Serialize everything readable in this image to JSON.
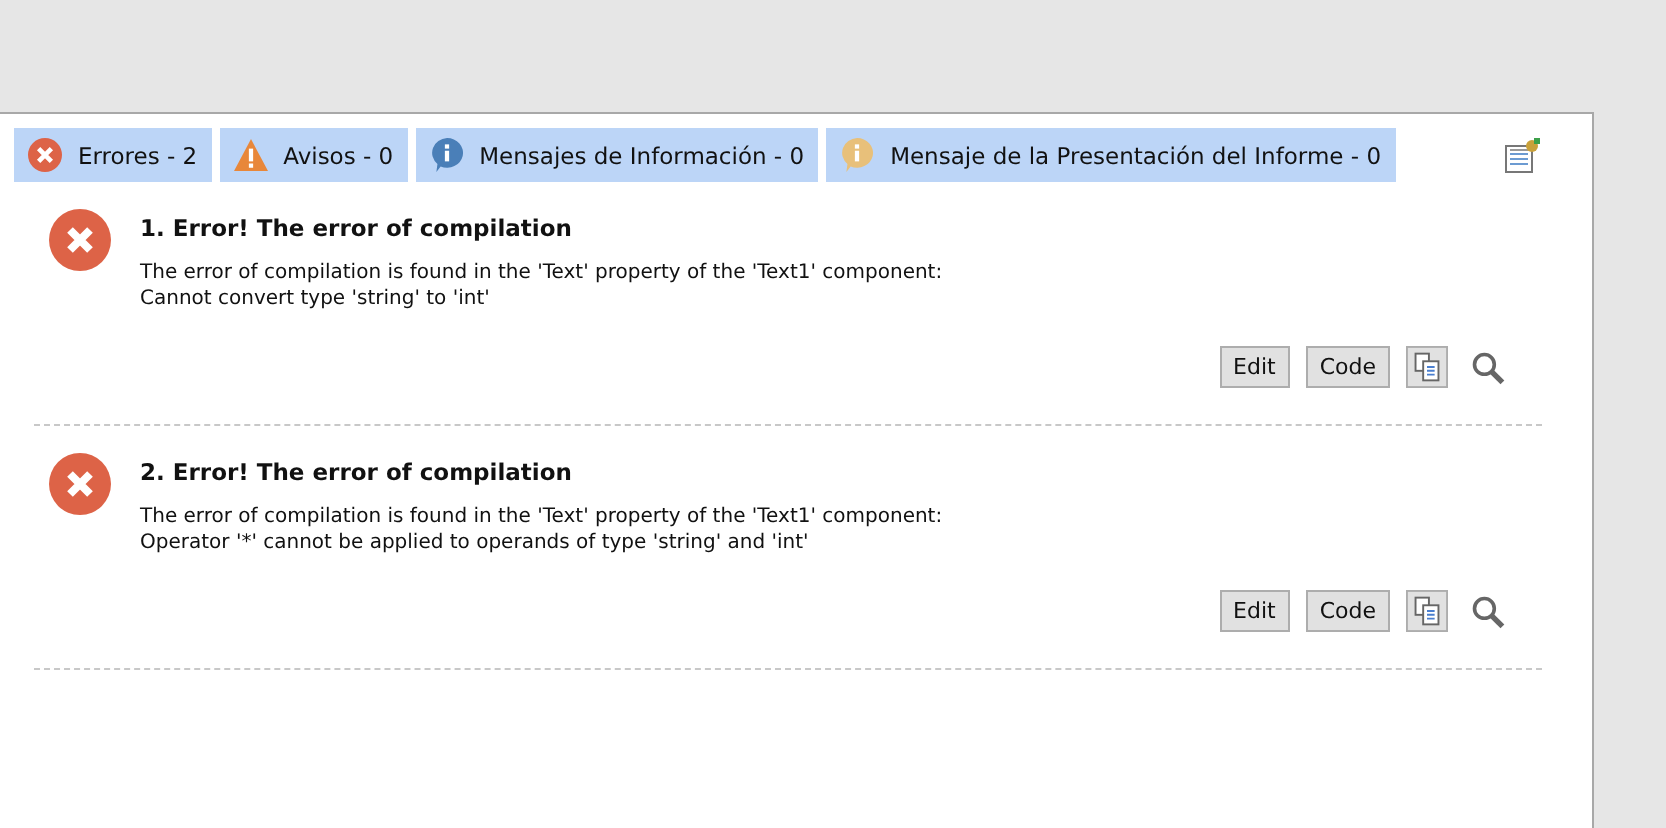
{
  "tabs": [
    {
      "kind": "error",
      "label": "Errores - 2"
    },
    {
      "kind": "warning",
      "label": "Avisos - 0"
    },
    {
      "kind": "info",
      "label": "Mensajes de Información - 0"
    },
    {
      "kind": "report",
      "label": "Mensaje de la Presentación del Informe - 0"
    }
  ],
  "messages": [
    {
      "title": "1. Error! The error of compilation",
      "lines": [
        "The error of compilation is found in the 'Text' property of the 'Text1' component:",
        "Cannot convert type 'string' to 'int'"
      ],
      "buttons": [
        "Edit",
        "Code"
      ]
    },
    {
      "title": "2. Error! The error of compilation",
      "lines": [
        "The error of compilation is found in the 'Text' property of the 'Text1' component:",
        "Operator '*' cannot be applied to operands of type 'string' and 'int'"
      ],
      "buttons": [
        "Edit",
        "Code"
      ]
    }
  ]
}
